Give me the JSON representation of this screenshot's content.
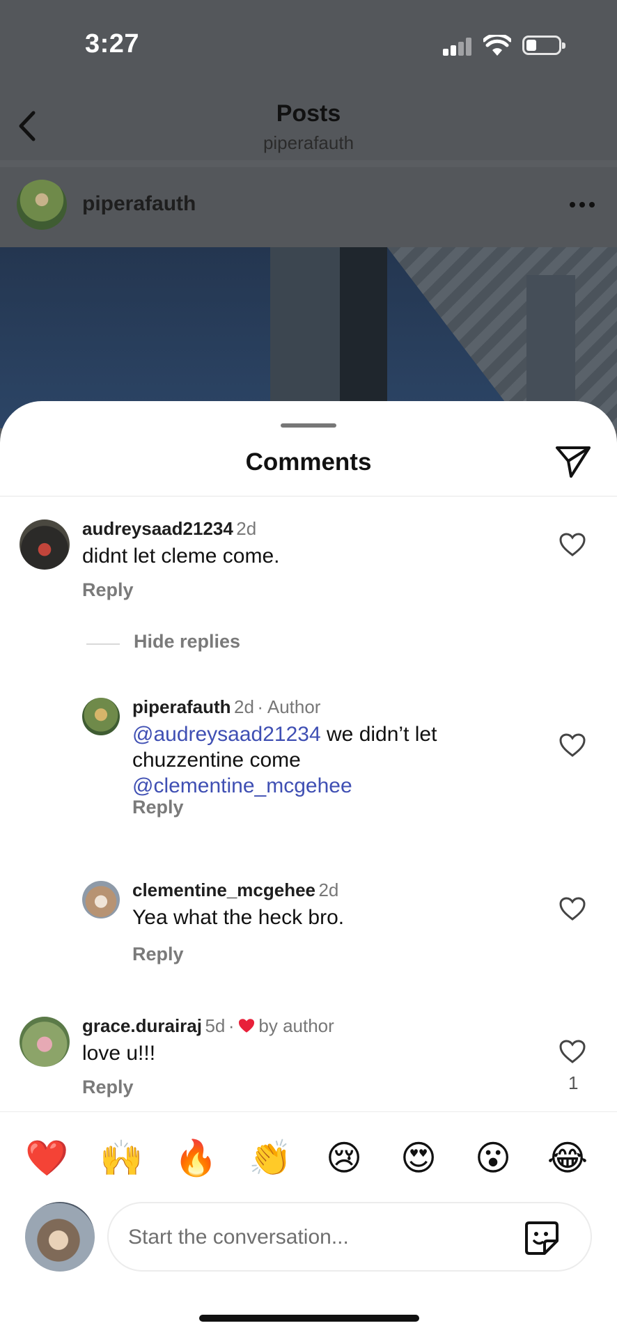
{
  "status_bar": {
    "time": "3:27"
  },
  "nav": {
    "title": "Posts",
    "subtitle": "piperafauth"
  },
  "post": {
    "username": "piperafauth"
  },
  "sheet": {
    "title": "Comments"
  },
  "comments": [
    {
      "username": "audreysaad21234",
      "time": "2d",
      "text": "didnt let cleme come.",
      "reply_label": "Reply"
    },
    {
      "hide_replies_label": "Hide replies"
    },
    {
      "username": "piperafauth",
      "time": "2d",
      "author_tag": "· Author",
      "mention1": "@audreysaad21234",
      "text": " we didn’t let chuzzentine come ",
      "mention2": "@clementine_mcgehee",
      "reply_label": "Reply"
    },
    {
      "username": "clementine_mcgehee",
      "time": "2d",
      "text": "Yea what the heck bro.",
      "reply_label": "Reply"
    },
    {
      "username": "grace.durairaj",
      "time": "5d",
      "separator": "·",
      "liked_by": "by author",
      "text": "love u!!!",
      "reply_label": "Reply",
      "like_count": "1"
    }
  ],
  "emoji_bar": {
    "emojis": [
      "❤️",
      "🙌",
      "🔥",
      "👏",
      "😢",
      "😍",
      "😮",
      "😂"
    ]
  },
  "composer": {
    "placeholder": "Start the conversation..."
  },
  "colors": {
    "mention": "#3f4fb3",
    "heart_red": "#e8203a",
    "overlay": "#54575b"
  },
  "icons": [
    "back-icon",
    "more-icon",
    "share-icon",
    "heart-icon",
    "sticker-icon",
    "signal-icon",
    "wifi-icon",
    "battery-icon"
  ]
}
